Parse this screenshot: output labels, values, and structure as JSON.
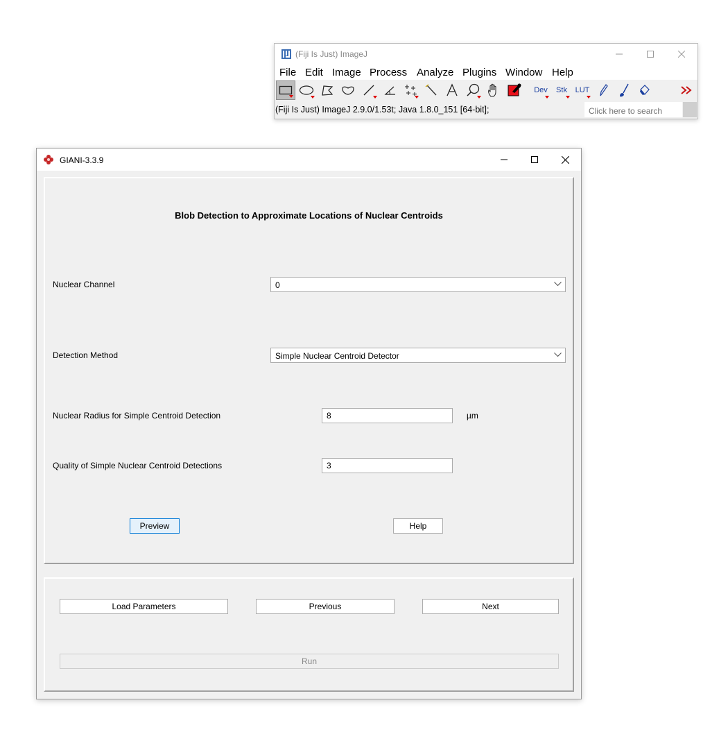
{
  "imagej": {
    "title": "(Fiji Is Just) ImageJ",
    "menus": [
      "File",
      "Edit",
      "Image",
      "Process",
      "Analyze",
      "Plugins",
      "Window",
      "Help"
    ],
    "tools": [
      {
        "icon": "rectangle-select-icon"
      },
      {
        "icon": "oval-select-icon"
      },
      {
        "icon": "polygon-select-icon"
      },
      {
        "icon": "freehand-select-icon"
      },
      {
        "icon": "line-tool-icon"
      },
      {
        "icon": "angle-tool-icon"
      },
      {
        "icon": "point-tool-icon"
      },
      {
        "icon": "wand-tool-icon"
      },
      {
        "icon": "text-tool-icon"
      },
      {
        "icon": "magnifier-icon"
      },
      {
        "icon": "hand-tool-icon"
      },
      {
        "icon": "color-picker-icon"
      },
      {
        "icon": "dev-menu-icon",
        "label": "Dev"
      },
      {
        "icon": "stk-menu-icon",
        "label": "Stk"
      },
      {
        "icon": "lut-menu-icon",
        "label": "LUT"
      },
      {
        "icon": "pencil-icon"
      },
      {
        "icon": "brush-icon"
      },
      {
        "icon": "flood-fill-icon"
      },
      {
        "icon": "more-tools-icon"
      }
    ],
    "status": "(Fiji Is Just) ImageJ 2.9.0/1.53t; Java 1.8.0_151 [64-bit];",
    "search_placeholder": "Click here to search"
  },
  "giani": {
    "title": "GIANI-3.3.9",
    "heading": "Blob Detection to Approximate Locations of Nuclear Centroids",
    "nuclear_channel": {
      "label": "Nuclear Channel",
      "value": "0"
    },
    "detection_method": {
      "label": "Detection Method",
      "value": "Simple Nuclear Centroid Detector"
    },
    "nuclear_radius": {
      "label": "Nuclear Radius for Simple Centroid Detection",
      "value": "8",
      "unit": "µm"
    },
    "quality": {
      "label": "Quality of Simple Nuclear Centroid Detections",
      "value": "3"
    },
    "preview_label": "Preview",
    "help_label": "Help",
    "load_label": "Load Parameters",
    "previous_label": "Previous",
    "next_label": "Next",
    "run_label": "Run"
  },
  "colors": {
    "accent": "#0078d7",
    "window_bg": "#f0f0f0",
    "title_red": "#cc2222"
  }
}
